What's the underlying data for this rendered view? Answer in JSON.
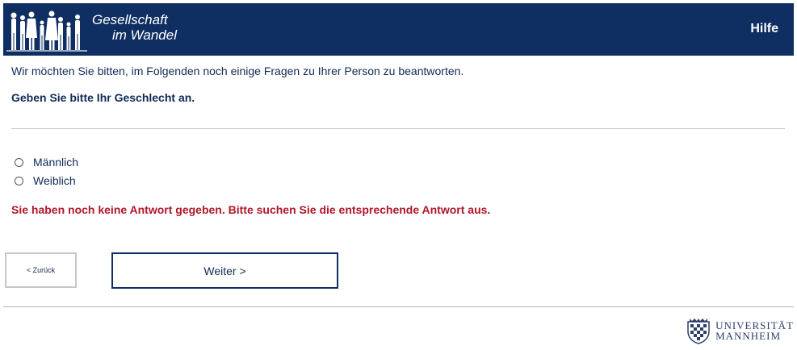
{
  "header": {
    "logo_line1": "Gesellschaft",
    "logo_line2": "im Wandel",
    "help_label": "Hilfe"
  },
  "intro_text": "Wir möchten Sie bitten, im Folgenden noch einige Fragen zu Ihrer Person zu beantworten.",
  "question_text": "Geben Sie bitte Ihr Geschlecht an.",
  "options": [
    {
      "label": "Männlich",
      "selected": false
    },
    {
      "label": "Weiblich",
      "selected": false
    }
  ],
  "error_text": "Sie haben noch keine Antwort gegeben. Bitte suchen Sie die entsprechende Antwort aus.",
  "buttons": {
    "back_label": "< Zurück",
    "next_label": "Weiter >"
  },
  "footer": {
    "uni_line1": "UNIVERSITÄT",
    "uni_line2": "MANNHEIM"
  },
  "colors": {
    "header_bg": "#0f2f63",
    "text": "#0f2a55",
    "error": "#b0172a"
  }
}
